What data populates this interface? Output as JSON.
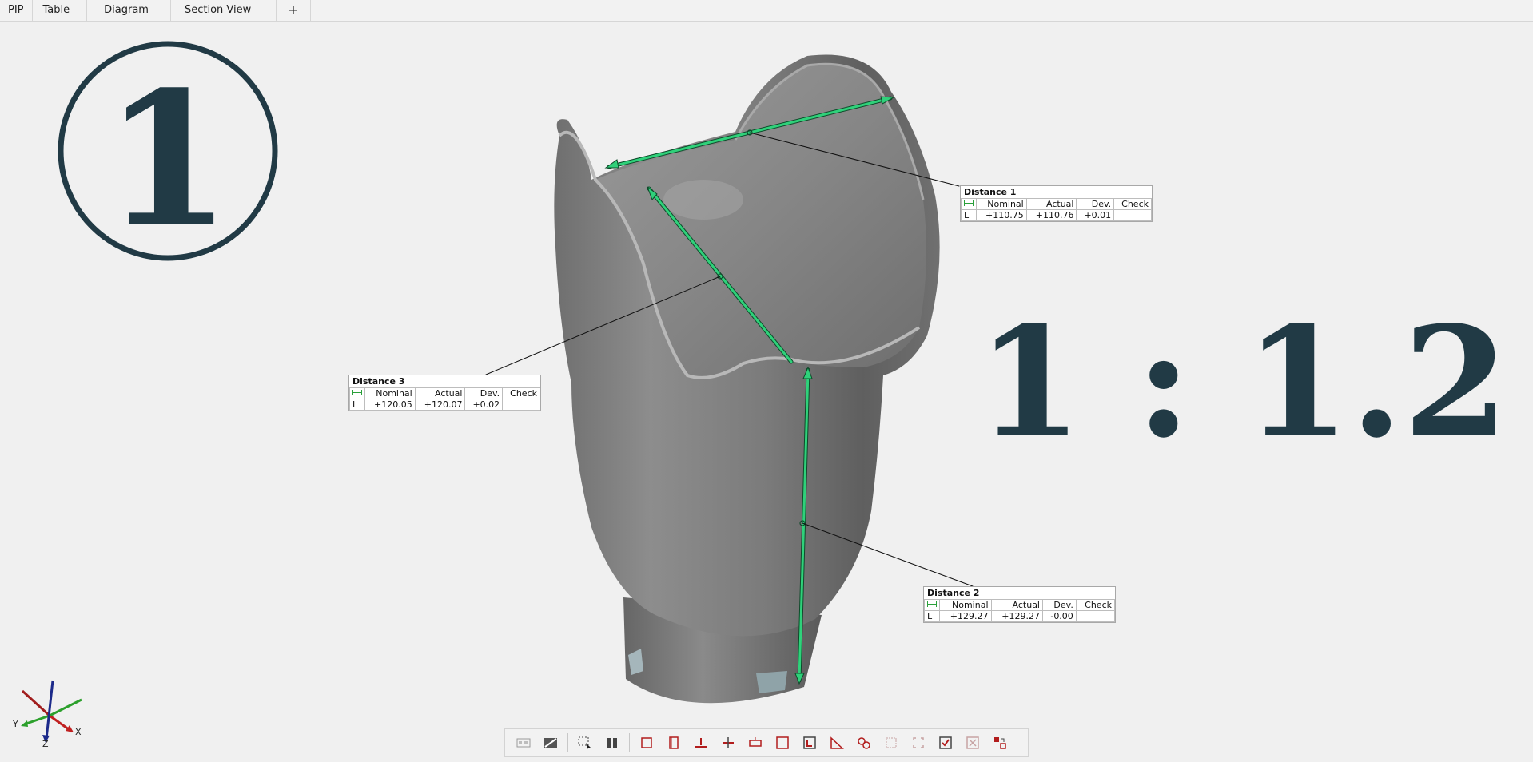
{
  "tabs": [
    {
      "label": "PIP"
    },
    {
      "label": "Table"
    },
    {
      "label": "Diagram"
    },
    {
      "label": "Section View"
    }
  ],
  "add_tab_label": "+",
  "badge": {
    "text": "1"
  },
  "scale": {
    "text": "1 : 1.2"
  },
  "colors": {
    "accent_text": "#213a45",
    "measure_green": "#2fd17a",
    "toolbar_icon_red": "#b21d1d"
  },
  "labels": [
    {
      "title": "Distance 1",
      "headers": [
        "Nominal",
        "Actual",
        "Dev.",
        "Check"
      ],
      "row": {
        "axis": "L",
        "nominal": "+110.75",
        "actual": "+110.76",
        "dev": "+0.01",
        "check": ""
      }
    },
    {
      "title": "Distance 2",
      "headers": [
        "Nominal",
        "Actual",
        "Dev.",
        "Check"
      ],
      "row": {
        "axis": "L",
        "nominal": "+129.27",
        "actual": "+129.27",
        "dev": "-0.00",
        "check": ""
      }
    },
    {
      "title": "Distance 3",
      "headers": [
        "Nominal",
        "Actual",
        "Dev.",
        "Check"
      ],
      "row": {
        "axis": "L",
        "nominal": "+120.05",
        "actual": "+120.07",
        "dev": "+0.02",
        "check": ""
      }
    }
  ],
  "axes": {
    "x": "X",
    "y": "Y",
    "z": "Z"
  },
  "toolbar_icons": [
    "viewport-layout-icon",
    "section-toggle-icon",
    "select-area-icon",
    "split-view-icon",
    "front-view-icon",
    "side-view-icon",
    "align-icon",
    "cut-plane-icon",
    "caption-icon",
    "frame-icon",
    "label-frame-icon",
    "ruler-icon",
    "connect-icon",
    "grid-icon",
    "fit-icon",
    "check-icon",
    "remove-check-icon",
    "export-icon"
  ]
}
